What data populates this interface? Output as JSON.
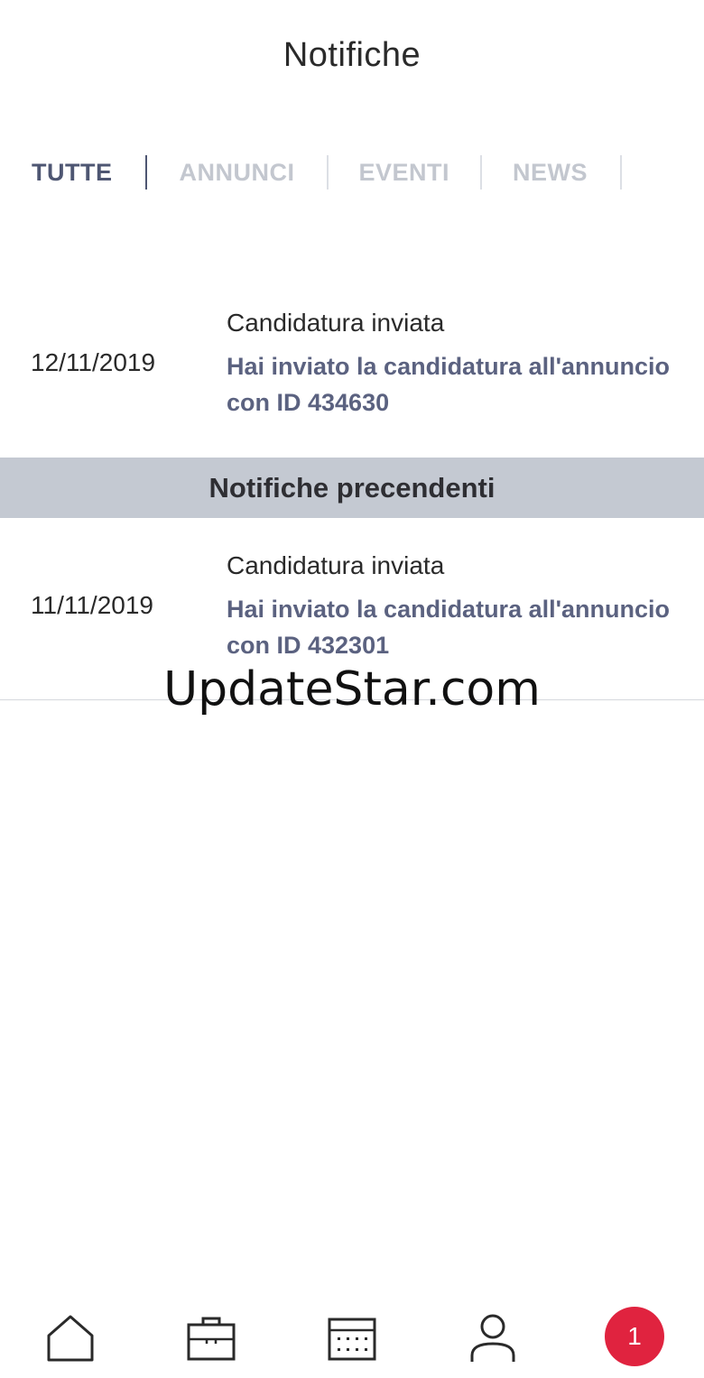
{
  "header": {
    "title": "Notifiche"
  },
  "tabs": [
    {
      "label": "TUTTE",
      "active": true
    },
    {
      "label": "ANNUNCI",
      "active": false
    },
    {
      "label": "EVENTI",
      "active": false
    },
    {
      "label": "NEWS",
      "active": false
    }
  ],
  "recent": [
    {
      "date": "12/11/2019",
      "title": "Candidatura inviata",
      "message": "Hai inviato la candidatura all'annuncio con ID 434630"
    }
  ],
  "previous_header": "Notifiche precendenti",
  "previous": [
    {
      "date": "11/11/2019",
      "title": "Candidatura inviata",
      "message": "Hai inviato la candidatura all'annuncio con ID 432301"
    }
  ],
  "watermark": "UpdateStar.com",
  "bottom_nav": {
    "items": [
      {
        "icon": "home-icon"
      },
      {
        "icon": "briefcase-icon"
      },
      {
        "icon": "calendar-icon"
      },
      {
        "icon": "user-icon"
      }
    ],
    "notifications_count": "1"
  },
  "colors": {
    "accent": "#4e5672",
    "inactive_tab": "#c3c7cf",
    "section_bg": "#c4c9d2",
    "badge": "#e0233f"
  }
}
